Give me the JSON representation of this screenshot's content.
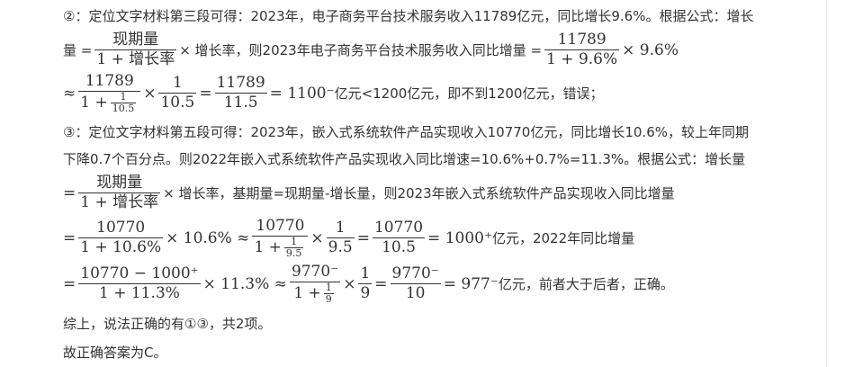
{
  "line1": "②：定位文字材料第三段可得：2023年，电子商务平台技术服务收入11789亿元，同比增长9.6%。根据公式：增长",
  "line2": {
    "lead": "量 =",
    "f1_num": "现期量",
    "f1_den": "1 + 增长率",
    "mid": "× 增长率，则2023年电子商务平台技术服务收入同比增量 =",
    "f2_num": "11789",
    "f2_den": "1 + 9.6%",
    "tail": "× 9.6%"
  },
  "line3": {
    "approx": "≈",
    "f1_num": "11789",
    "f1_den_a": "1 +",
    "f1_den_sub_num": "1",
    "f1_den_sub_den": "10.5",
    "times": "×",
    "f2_num": "1",
    "f2_den": "10.5",
    "eq": "=",
    "f3_num": "11789",
    "f3_den": "11.5",
    "result": "= 1100⁻",
    "text": "亿元<1200亿元，即不到1200亿元，错误；"
  },
  "line4": "③：定位文字材料第五段可得：2023年，嵌入式系统软件产品实现收入10770亿元，同比增长10.6%，较上年同期",
  "line5": "下降0.7个百分点。则2022年嵌入式系统软件产品实现收入同比增速=10.6%+0.7%=11.3%。根据公式：增长量",
  "line6": {
    "lead": "=",
    "f1_num": "现期量",
    "f1_den": "1 + 增长率",
    "mid": "× 增长率，基期量=现期量-增长量，则2023年嵌入式系统软件产品实现收入同比增量"
  },
  "line7": {
    "lead": "=",
    "f1_num": "10770",
    "f1_den": "1 + 10.6%",
    "a": "× 10.6% ≈",
    "f2_num": "10770",
    "f2_den_a": "1 +",
    "f2_sub_num": "1",
    "f2_sub_den": "9.5",
    "times": "×",
    "f3_num": "1",
    "f3_den": "9.5",
    "eq": "=",
    "f4_num": "10770",
    "f4_den": "10.5",
    "result": "= 1000⁺",
    "text": "亿元，2022年同比增量"
  },
  "line8": {
    "lead": "=",
    "f1_num": "10770 − 1000⁺",
    "f1_den": "1 + 11.3%",
    "a": "× 11.3% ≈",
    "f2_num": "9770⁻",
    "f2_den_a": "1 +",
    "f2_sub_num": "1",
    "f2_sub_den": "9",
    "times": "×",
    "f3_num": "1",
    "f3_den": "9",
    "eq": "=",
    "f4_num": "9770⁻",
    "f4_den": "10",
    "result": "= 977⁻",
    "text": "亿元，前者大于后者，正确。"
  },
  "line9": "综上，说法正确的有①③，共2项。",
  "line10": "故正确答案为C。"
}
